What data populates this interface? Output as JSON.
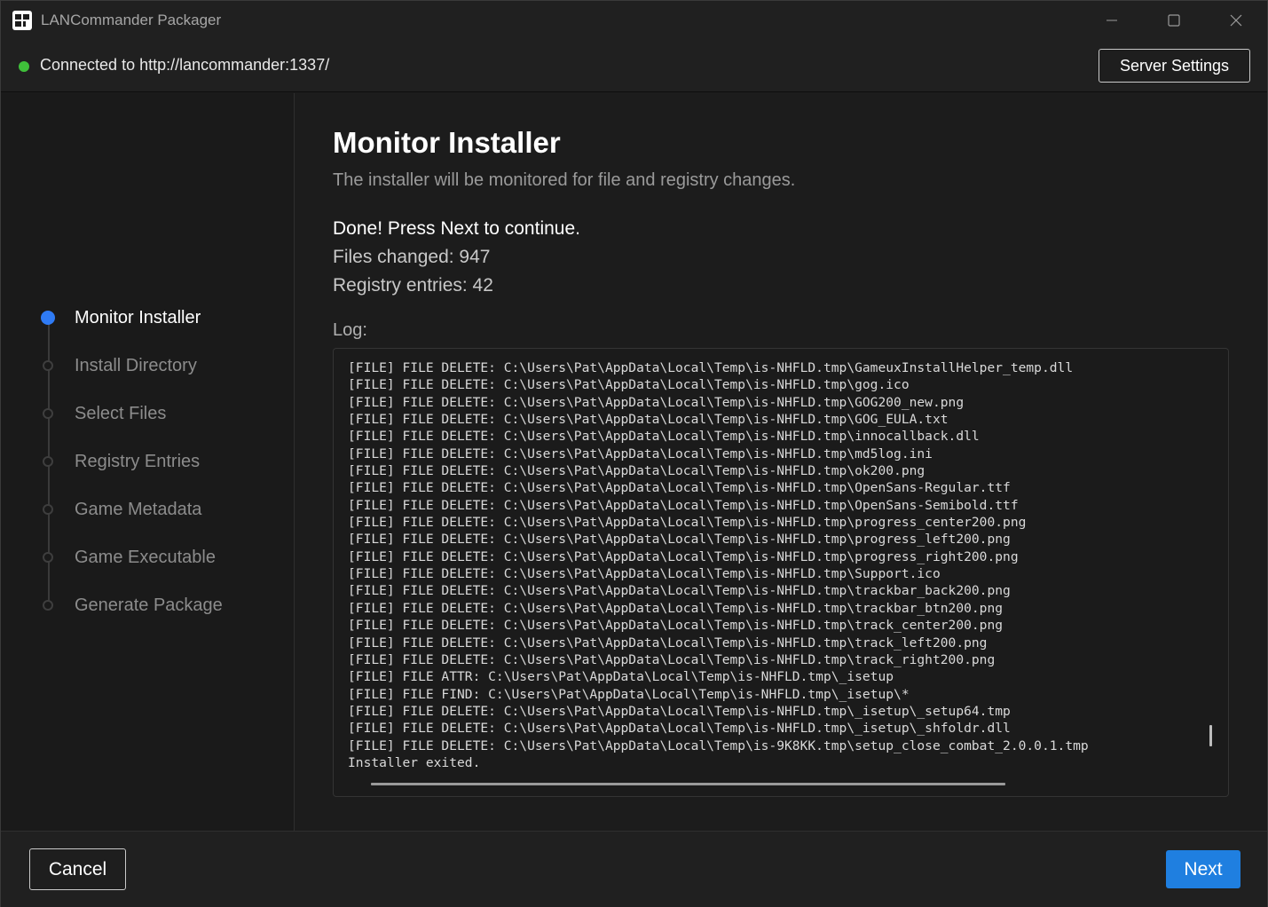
{
  "app": {
    "title": "LANCommander Packager",
    "icon": "app-logo-icon"
  },
  "window_controls": {
    "minimize": "minimize-icon",
    "maximize": "maximize-icon",
    "close": "close-icon"
  },
  "connection": {
    "status_text": "Connected to http://lancommander:1337/",
    "status_color": "#3fbf3a",
    "server_settings_label": "Server Settings"
  },
  "steps": [
    {
      "label": "Monitor Installer",
      "active": true
    },
    {
      "label": "Install Directory",
      "active": false
    },
    {
      "label": "Select Files",
      "active": false
    },
    {
      "label": "Registry Entries",
      "active": false
    },
    {
      "label": "Game Metadata",
      "active": false
    },
    {
      "label": "Game Executable",
      "active": false
    },
    {
      "label": "Generate Package",
      "active": false
    }
  ],
  "main": {
    "title": "Monitor Installer",
    "subtitle": "The installer will be monitored for file and registry changes.",
    "done_text": "Done! Press Next to continue.",
    "files_changed": "Files changed: 947",
    "registry_entries": "Registry entries: 42",
    "log_label": "Log:",
    "log_lines": [
      "[FILE] FILE DELETE: C:\\Users\\Pat\\AppData\\Local\\Temp\\is-NHFLD.tmp\\GameuxInstallHelper_temp.dll",
      "[FILE] FILE DELETE: C:\\Users\\Pat\\AppData\\Local\\Temp\\is-NHFLD.tmp\\gog.ico",
      "[FILE] FILE DELETE: C:\\Users\\Pat\\AppData\\Local\\Temp\\is-NHFLD.tmp\\GOG200_new.png",
      "[FILE] FILE DELETE: C:\\Users\\Pat\\AppData\\Local\\Temp\\is-NHFLD.tmp\\GOG_EULA.txt",
      "[FILE] FILE DELETE: C:\\Users\\Pat\\AppData\\Local\\Temp\\is-NHFLD.tmp\\innocallback.dll",
      "[FILE] FILE DELETE: C:\\Users\\Pat\\AppData\\Local\\Temp\\is-NHFLD.tmp\\md5log.ini",
      "[FILE] FILE DELETE: C:\\Users\\Pat\\AppData\\Local\\Temp\\is-NHFLD.tmp\\ok200.png",
      "[FILE] FILE DELETE: C:\\Users\\Pat\\AppData\\Local\\Temp\\is-NHFLD.tmp\\OpenSans-Regular.ttf",
      "[FILE] FILE DELETE: C:\\Users\\Pat\\AppData\\Local\\Temp\\is-NHFLD.tmp\\OpenSans-Semibold.ttf",
      "[FILE] FILE DELETE: C:\\Users\\Pat\\AppData\\Local\\Temp\\is-NHFLD.tmp\\progress_center200.png",
      "[FILE] FILE DELETE: C:\\Users\\Pat\\AppData\\Local\\Temp\\is-NHFLD.tmp\\progress_left200.png",
      "[FILE] FILE DELETE: C:\\Users\\Pat\\AppData\\Local\\Temp\\is-NHFLD.tmp\\progress_right200.png",
      "[FILE] FILE DELETE: C:\\Users\\Pat\\AppData\\Local\\Temp\\is-NHFLD.tmp\\Support.ico",
      "[FILE] FILE DELETE: C:\\Users\\Pat\\AppData\\Local\\Temp\\is-NHFLD.tmp\\trackbar_back200.png",
      "[FILE] FILE DELETE: C:\\Users\\Pat\\AppData\\Local\\Temp\\is-NHFLD.tmp\\trackbar_btn200.png",
      "[FILE] FILE DELETE: C:\\Users\\Pat\\AppData\\Local\\Temp\\is-NHFLD.tmp\\track_center200.png",
      "[FILE] FILE DELETE: C:\\Users\\Pat\\AppData\\Local\\Temp\\is-NHFLD.tmp\\track_left200.png",
      "[FILE] FILE DELETE: C:\\Users\\Pat\\AppData\\Local\\Temp\\is-NHFLD.tmp\\track_right200.png",
      "[FILE] FILE ATTR: C:\\Users\\Pat\\AppData\\Local\\Temp\\is-NHFLD.tmp\\_isetup",
      "[FILE] FILE FIND: C:\\Users\\Pat\\AppData\\Local\\Temp\\is-NHFLD.tmp\\_isetup\\*",
      "[FILE] FILE DELETE: C:\\Users\\Pat\\AppData\\Local\\Temp\\is-NHFLD.tmp\\_isetup\\_setup64.tmp",
      "[FILE] FILE DELETE: C:\\Users\\Pat\\AppData\\Local\\Temp\\is-NHFLD.tmp\\_isetup\\_shfoldr.dll",
      "[FILE] FILE DELETE: C:\\Users\\Pat\\AppData\\Local\\Temp\\is-9K8KK.tmp\\setup_close_combat_2.0.0.1.tmp",
      "Installer exited."
    ]
  },
  "footer": {
    "cancel_label": "Cancel",
    "next_label": "Next"
  },
  "colors": {
    "accent": "#1f7fe0",
    "active_step": "#2f7bf5",
    "connected": "#3fbf3a"
  }
}
